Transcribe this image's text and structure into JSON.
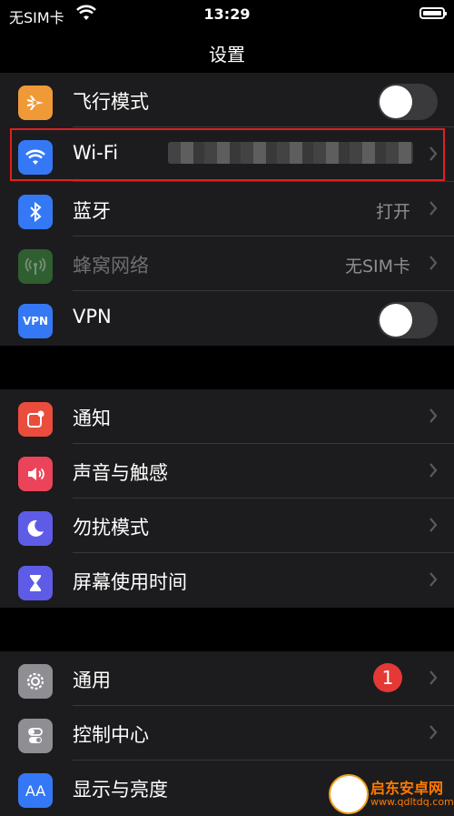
{
  "status": {
    "carrier": "无SIM卡",
    "time": "13:29"
  },
  "nav": {
    "title": "设置"
  },
  "group1": [
    {
      "label": "飞行模式",
      "icon": "airplane-icon",
      "color": "#f09a37",
      "control": "toggle",
      "on": false
    },
    {
      "label": "Wi-Fi",
      "icon": "wifi-icon",
      "color": "#3478f6",
      "value": "",
      "control": "chevron"
    },
    {
      "label": "蓝牙",
      "icon": "bluetooth-icon",
      "color": "#3478f6",
      "value": "打开",
      "control": "chevron"
    },
    {
      "label": "蜂窝网络",
      "icon": "cellular-icon",
      "color": "#2f5f30",
      "value": "无SIM卡",
      "control": "chevron",
      "dim": true
    },
    {
      "label": "VPN",
      "icon": "vpn-icon",
      "color": "#3478f6",
      "icon_text": "VPN",
      "control": "toggle",
      "on": false
    }
  ],
  "group2": [
    {
      "label": "通知",
      "icon": "notifications-icon",
      "color": "#eb4d3d"
    },
    {
      "label": "声音与触感",
      "icon": "sound-icon",
      "color": "#eb445a"
    },
    {
      "label": "勿扰模式",
      "icon": "moon-icon",
      "color": "#5e5ce6"
    },
    {
      "label": "屏幕使用时间",
      "icon": "hourglass-icon",
      "color": "#5e5ce6"
    }
  ],
  "group3": [
    {
      "label": "通用",
      "icon": "gear-icon",
      "color": "#8e8e93",
      "badge": "1"
    },
    {
      "label": "控制中心",
      "icon": "switches-icon",
      "color": "#8e8e93"
    },
    {
      "label": "显示与亮度",
      "icon": "display-icon",
      "color": "#3478f6",
      "icon_text": "AA"
    }
  ],
  "watermark": {
    "text": "启东安卓网",
    "url": "www.qdltdq.com"
  }
}
